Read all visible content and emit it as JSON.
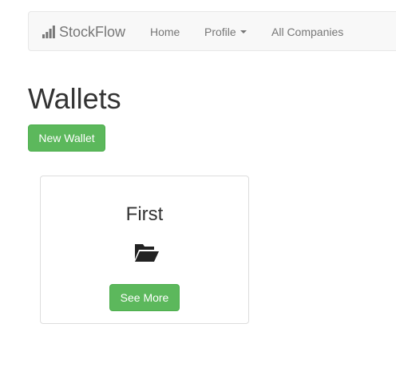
{
  "navbar": {
    "brand": "StockFlow",
    "brand_icon": "signal-bars-icon",
    "items": [
      {
        "label": "Home"
      },
      {
        "label": "Profile",
        "dropdown": true
      },
      {
        "label": "All Companies"
      }
    ]
  },
  "main": {
    "title": "Wallets",
    "new_wallet_label": "New Wallet",
    "wallets": [
      {
        "name": "First",
        "icon": "folder-open-icon",
        "button_label": "See More"
      }
    ]
  },
  "colors": {
    "success": "#5cb85c",
    "navbar_bg": "#f8f8f8",
    "nav_text": "#777777"
  }
}
